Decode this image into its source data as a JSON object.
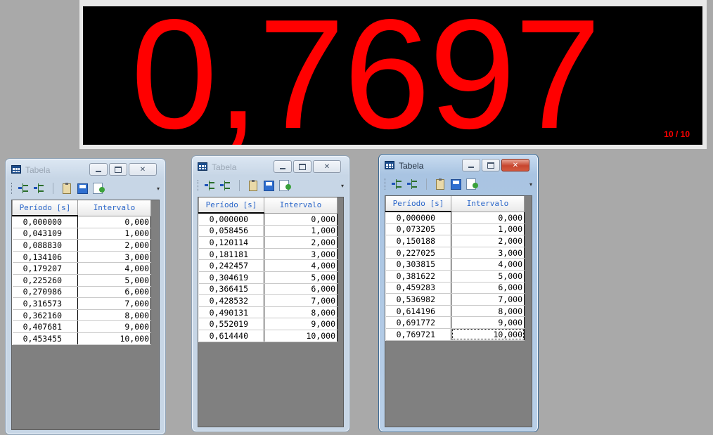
{
  "display": {
    "value": "0,7697",
    "counter": "10 / 10"
  },
  "windows": [
    {
      "title": "Tabela",
      "active": false,
      "columns": [
        "Período [s]",
        "Intervalo"
      ],
      "rows": [
        [
          "0,000000",
          "0,000"
        ],
        [
          "0,043109",
          "1,000"
        ],
        [
          "0,088830",
          "2,000"
        ],
        [
          "0,134106",
          "3,000"
        ],
        [
          "0,179207",
          "4,000"
        ],
        [
          "0,225260",
          "5,000"
        ],
        [
          "0,270986",
          "6,000"
        ],
        [
          "0,316573",
          "7,000"
        ],
        [
          "0,362160",
          "8,000"
        ],
        [
          "0,407681",
          "9,000"
        ],
        [
          "0,453455",
          "10,000"
        ]
      ]
    },
    {
      "title": "Tabela",
      "active": false,
      "columns": [
        "Período [s]",
        "Intervalo"
      ],
      "rows": [
        [
          "0,000000",
          "0,000"
        ],
        [
          "0,058456",
          "1,000"
        ],
        [
          "0,120114",
          "2,000"
        ],
        [
          "0,181181",
          "3,000"
        ],
        [
          "0,242457",
          "4,000"
        ],
        [
          "0,304619",
          "5,000"
        ],
        [
          "0,366415",
          "6,000"
        ],
        [
          "0,428532",
          "7,000"
        ],
        [
          "0,490131",
          "8,000"
        ],
        [
          "0,552019",
          "9,000"
        ],
        [
          "0,614440",
          "10,000"
        ]
      ]
    },
    {
      "title": "Tabela",
      "active": true,
      "columns": [
        "Período [s]",
        "Intervalo"
      ],
      "rows": [
        [
          "0,000000",
          "0,000"
        ],
        [
          "0,073205",
          "1,000"
        ],
        [
          "0,150188",
          "2,000"
        ],
        [
          "0,227025",
          "3,000"
        ],
        [
          "0,303815",
          "4,000"
        ],
        [
          "0,381622",
          "5,000"
        ],
        [
          "0,459283",
          "6,000"
        ],
        [
          "0,536982",
          "7,000"
        ],
        [
          "0,614196",
          "8,000"
        ],
        [
          "0,691772",
          "9,000"
        ],
        [
          "0,769721",
          "10,000"
        ]
      ]
    }
  ],
  "window_buttons": {
    "minimize": "minimize-icon",
    "maximize": "maximize-icon",
    "close": "close-icon"
  },
  "toolbar_icons": [
    "add-column-icon",
    "remove-column-icon",
    "clipboard-icon",
    "save-icon",
    "export-icon"
  ]
}
